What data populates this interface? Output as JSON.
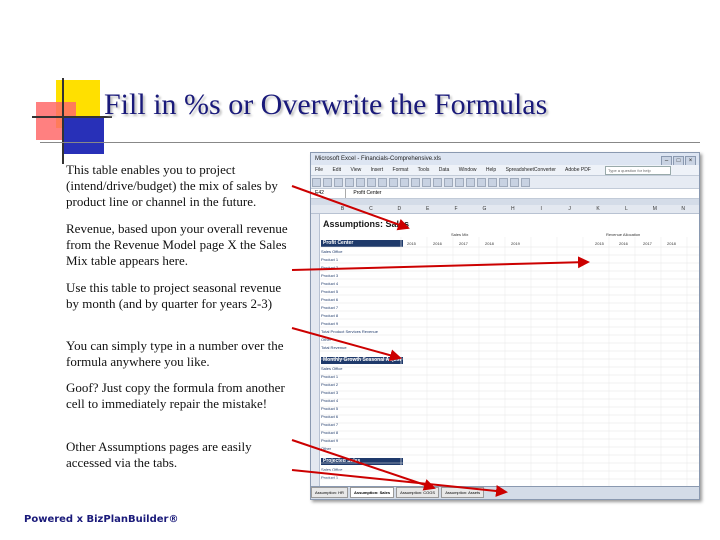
{
  "title": "Fill in %s or Overwrite the Formulas",
  "notes": [
    "This table enables you to project (intend/drive/budget) the mix of sales by product line or channel in the future.",
    "Revenue, based upon your overall revenue from the Revenue Model page X the Sales Mix table appears here.",
    "Use this table to project seasonal revenue by month (and by quarter for years 2-3)",
    "You can simply type in a number over the formula anywhere you like.",
    "Goof? Just copy the formula from another cell to immediately repair the mistake!",
    "Other Assumptions pages are easily accessed via the tabs."
  ],
  "footer": "Powered x BizPlanBuilder®",
  "excel": {
    "title": "Microsoft Excel - Financials-Comprehensive.xls",
    "menu": [
      "File",
      "Edit",
      "View",
      "Insert",
      "Format",
      "Tools",
      "Data",
      "Window",
      "Help",
      "SpreadsheetConverter",
      "Adobe PDF"
    ],
    "help_placeholder": "Type a question for help",
    "name_box": "E42",
    "formula_value": "Profit Center",
    "columns": [
      "B",
      "C",
      "D",
      "E",
      "F",
      "G",
      "H",
      "I",
      "J",
      "K",
      "L",
      "M",
      "N"
    ],
    "sheet_heading": "Assumptions: Sales",
    "sections": {
      "sales_mix": "Sales Mix",
      "revenue_allocation": "Revenue Allocation",
      "profit_center": "Profit Center",
      "monthly": "Monthly Growth Seasonal Adjust",
      "projected": "Projected Sales"
    },
    "years": [
      "2015",
      "2016",
      "2017",
      "2018",
      "2019"
    ],
    "products": [
      "Sales Office",
      "Product 1",
      "Product 2",
      "Product 3",
      "Product 4",
      "Product 5",
      "Product 6",
      "Product 7",
      "Product 8",
      "Product 9",
      "Total Product Services Revenue",
      "Other",
      "Total Revenue"
    ],
    "tabs": [
      "Assumption: HR",
      "Assumption: Sales",
      "Assumption: COGS",
      "Assumption: Assets"
    ]
  }
}
